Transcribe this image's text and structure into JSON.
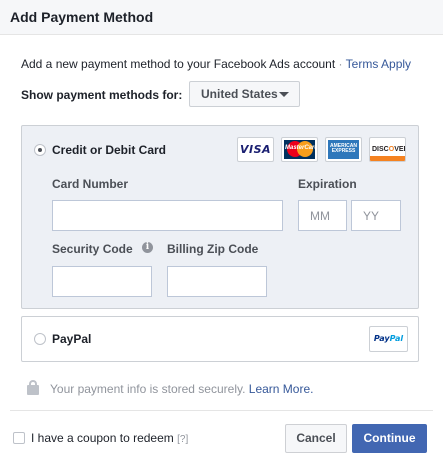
{
  "dialog": {
    "title": "Add Payment Method"
  },
  "intro": {
    "text": "Add a new payment method to your Facebook Ads account",
    "separator": "·",
    "terms_link": "Terms Apply"
  },
  "country_selector": {
    "label": "Show payment methods for:",
    "value": "United States"
  },
  "credit_card": {
    "option_label": "Credit or Debit Card",
    "selected": true,
    "brands": {
      "visa": "VISA",
      "mastercard": "MasterCard",
      "amex": "AMERICAN EXPRESS",
      "discover": "DISCOVER"
    },
    "fields": {
      "card_number_label": "Card Number",
      "card_number_value": "",
      "expiration_label": "Expiration",
      "month_placeholder": "MM",
      "year_placeholder": "YY",
      "security_code_label": "Security Code",
      "billing_zip_label": "Billing Zip Code"
    }
  },
  "paypal": {
    "option_label": "PayPal",
    "selected": false,
    "logo_part1": "Pay",
    "logo_part2": "Pal"
  },
  "secure": {
    "text": "Your payment info is stored securely.",
    "link": "Learn More."
  },
  "coupon": {
    "label": "I have a coupon to redeem",
    "help": "[?]",
    "checked": false
  },
  "buttons": {
    "cancel": "Cancel",
    "continue": "Continue"
  },
  "colors": {
    "primary": "#4267b2",
    "link": "#365899",
    "panel_bg": "#edf0f5",
    "border": "#ccd0d5",
    "header_bg": "#f6f7f9"
  },
  "icons": [
    "radio-selected",
    "radio-unselected",
    "info-icon",
    "lock-icon",
    "dropdown-caret-icon",
    "visa-logo",
    "mastercard-logo",
    "amex-logo",
    "discover-logo",
    "paypal-logo"
  ]
}
